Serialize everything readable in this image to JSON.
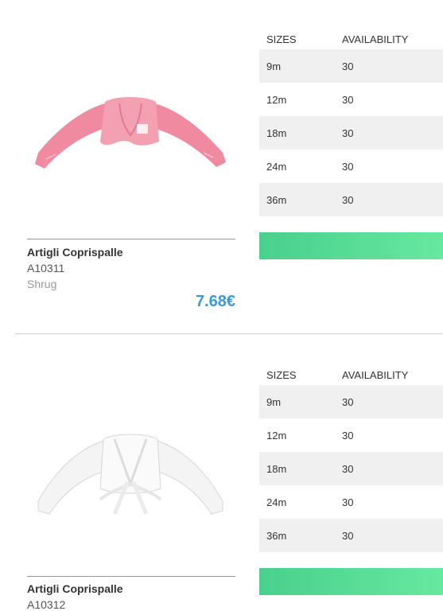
{
  "products": [
    {
      "name": "Artigli Coprispalle",
      "code": "A10311",
      "type": "Shrug",
      "price": "7.68€",
      "image_icon": "pink-shrug-image",
      "color": "#f08aa0",
      "headers": {
        "sizes": "SIZES",
        "availability": "AVAILABILITY"
      },
      "rows": [
        {
          "size": "9m",
          "qty": "30"
        },
        {
          "size": "12m",
          "qty": "30"
        },
        {
          "size": "18m",
          "qty": "30"
        },
        {
          "size": "24m",
          "qty": "30"
        },
        {
          "size": "36m",
          "qty": "30"
        }
      ]
    },
    {
      "name": "Artigli Coprispalle",
      "code": "A10312",
      "type": "",
      "price": "",
      "image_icon": "white-shrug-image",
      "color": "#f4f4f4",
      "headers": {
        "sizes": "SIZES",
        "availability": "AVAILABILITY"
      },
      "rows": [
        {
          "size": "9m",
          "qty": "30"
        },
        {
          "size": "12m",
          "qty": "30"
        },
        {
          "size": "18m",
          "qty": "30"
        },
        {
          "size": "24m",
          "qty": "30"
        },
        {
          "size": "36m",
          "qty": "30"
        }
      ]
    }
  ],
  "colors": {
    "price": "#3a9ad9",
    "cta_start": "#49d08c",
    "cta_end": "#66e8a0",
    "row_shade": "#f0f0f0"
  }
}
